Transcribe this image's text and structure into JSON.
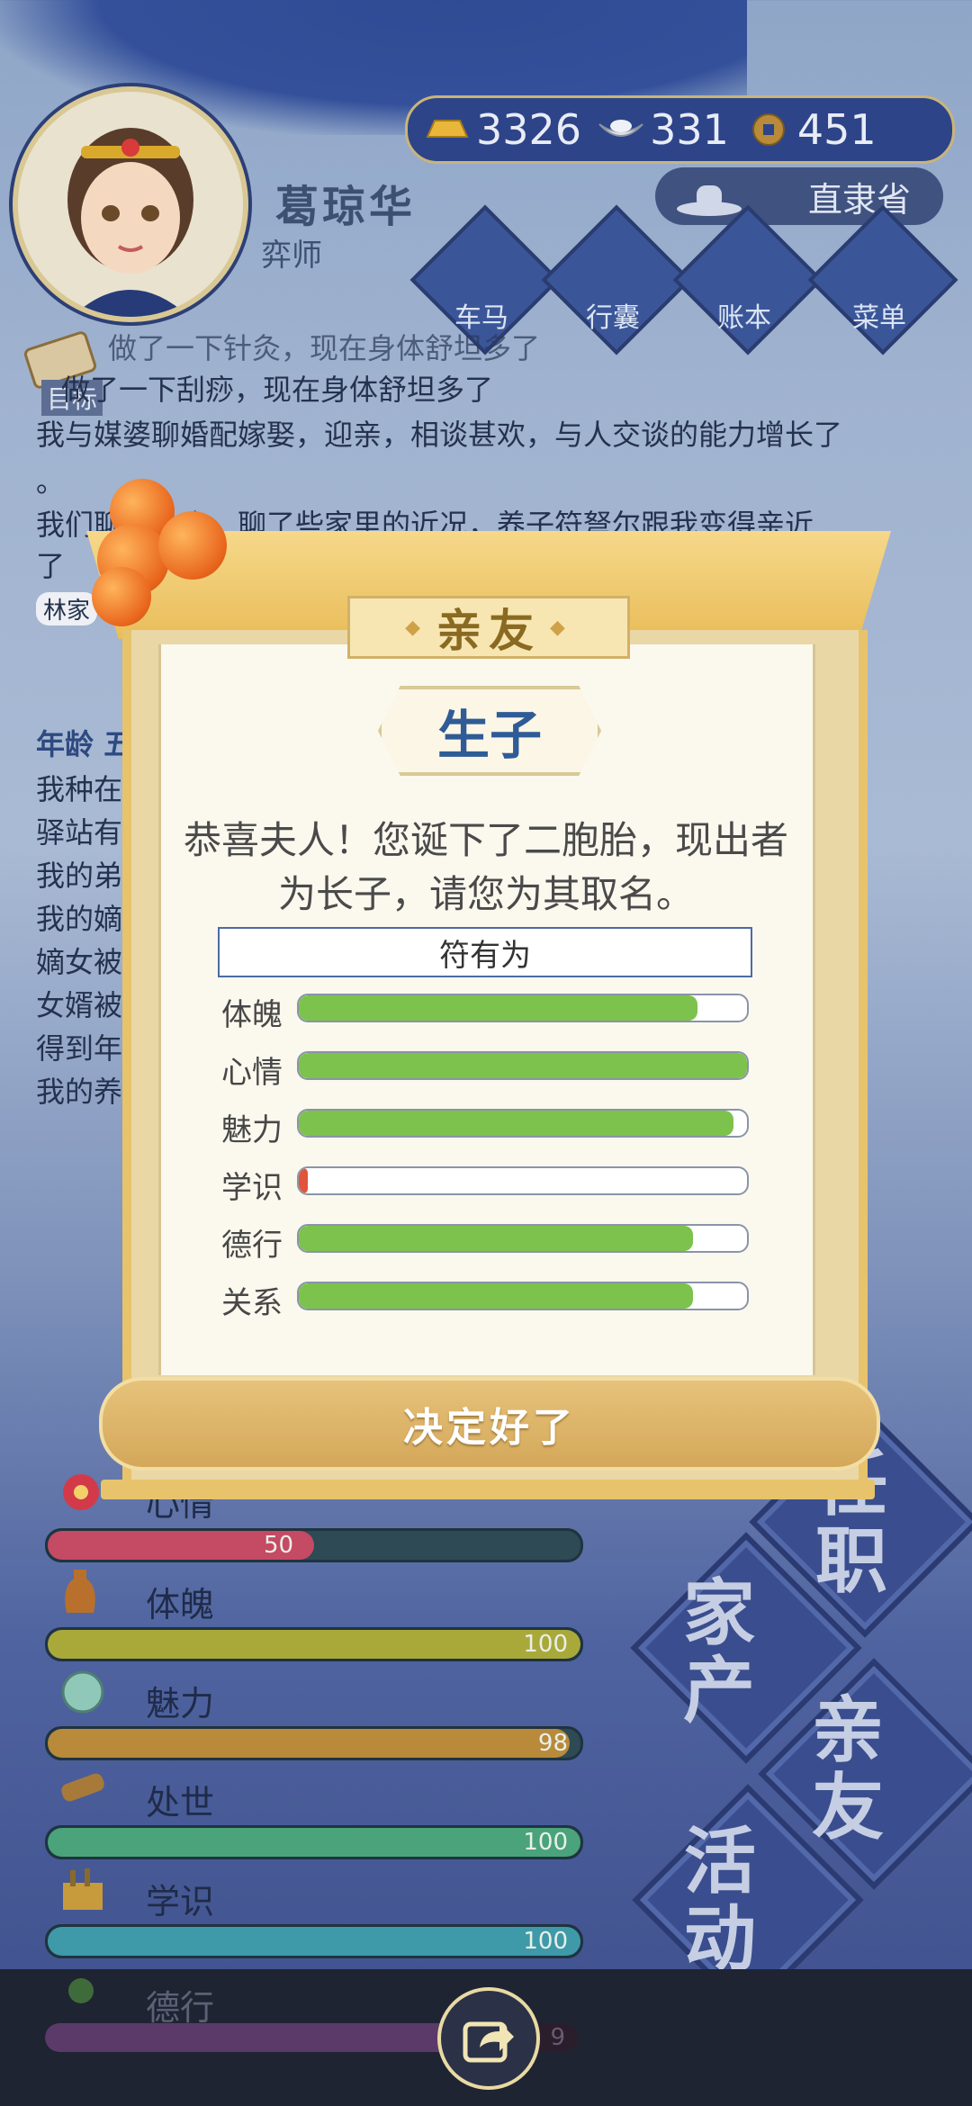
{
  "header": {
    "player_name": "葛琼华",
    "player_title": "弈师",
    "resources": [
      {
        "icon": "gold-ingot-icon",
        "value": "3326"
      },
      {
        "icon": "silver-ingot-icon",
        "value": "331"
      },
      {
        "icon": "copper-coin-icon",
        "value": "451"
      }
    ],
    "province": "直隶省",
    "nav": [
      {
        "label": "车马",
        "icon": "carriage-icon"
      },
      {
        "label": "行囊",
        "icon": "bag-icon"
      },
      {
        "label": "账本",
        "icon": "ledger-icon"
      },
      {
        "label": "菜单",
        "icon": "menu-dots-icon"
      }
    ],
    "goal_label": "目标"
  },
  "log": {
    "lines": [
      "做了一下针灸，现在身体舒坦多了",
      "做了一下刮痧，现在身体舒坦多了",
      "我与媒婆聊婚配嫁娶，迎亲，相谈甚欢，与人交谈的能力增长了",
      "。",
      "我们聊了一会，聊了些家里的近况，养子符弩尔跟我变得亲近",
      "了",
      "林家"
    ],
    "age_label": "年龄 五",
    "fragments": [
      "我种在",
      "驿站有",
      "我的弟",
      "我的嫡",
      "嫡女被",
      "女婿被",
      "得到年",
      "我的养"
    ]
  },
  "modal": {
    "tab_title": "亲友",
    "subtitle": "生子",
    "message": "恭喜夫人！您诞下了二胞胎，现出者为长子，请您为其取名。",
    "child_name": "符有为",
    "stats": [
      {
        "label": "体魄",
        "fraction": 0.89,
        "color": "#7cc24c"
      },
      {
        "label": "心情",
        "fraction": 1.0,
        "color": "#7cc24c"
      },
      {
        "label": "魅力",
        "fraction": 0.97,
        "color": "#7cc24c"
      },
      {
        "label": "学识",
        "fraction": 0.02,
        "color": "#e2543a"
      },
      {
        "label": "德行",
        "fraction": 0.88,
        "color": "#7cc24c"
      },
      {
        "label": "关系",
        "fraction": 0.88,
        "color": "#7cc24c"
      }
    ],
    "confirm_label": "决定好了"
  },
  "player_stats": [
    {
      "label": "心情",
      "value": "50",
      "fraction": 0.5,
      "color": "#c54a63",
      "icon": "flower-icon"
    },
    {
      "label": "体魄",
      "value": "100",
      "fraction": 1.0,
      "color": "#a9a93a",
      "icon": "vase-icon"
    },
    {
      "label": "魅力",
      "value": "100",
      "fraction": 1.0,
      "color": "#b8a83e",
      "icon": "jade-icon"
    },
    {
      "label": "处世",
      "value": "98",
      "fraction": 0.98,
      "color": "#b88a3a",
      "icon": "scroll-icon"
    },
    {
      "label": "学识",
      "value": "100",
      "fraction": 1.0,
      "color": "#4aa37a",
      "icon": "books-icon"
    },
    {
      "label": "德行",
      "value": "100",
      "fraction": 1.0,
      "color": "#3e9aa8",
      "icon": "bead-icon"
    },
    {
      "label": "",
      "value": "9",
      "fraction": 0.9,
      "color": "#5b3a6a",
      "icon": ""
    }
  ],
  "side_menu": [
    "任职",
    "家产",
    "亲友",
    "活动"
  ],
  "colors": {
    "accent_gold": "#e7c36c",
    "navy": "#34509a"
  }
}
